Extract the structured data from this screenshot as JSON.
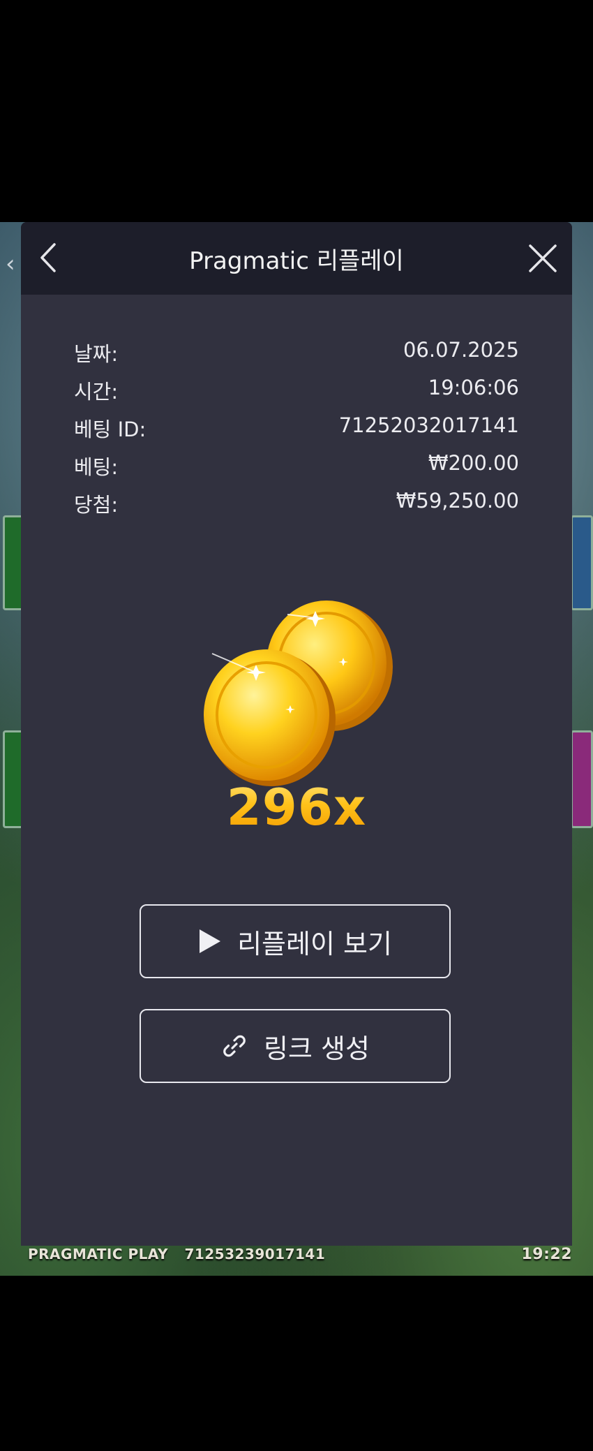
{
  "modal": {
    "title": "Pragmatic 리플레이",
    "info": [
      {
        "label": "날짜:",
        "value": "06.07.2025"
      },
      {
        "label": "시간:",
        "value": "19:06:06"
      },
      {
        "label": "베팅 ID:",
        "value": "71252032017141"
      },
      {
        "label": "베팅:",
        "value": "₩200.00"
      },
      {
        "label": "당첨:",
        "value": "₩59,250.00"
      }
    ],
    "multiplier": "296x",
    "buttons": {
      "replay_label": "리플레이 보기",
      "link_label": "링크 생성"
    }
  },
  "game_footer": {
    "brand": "PRAGMATIC PLAY",
    "round_id": "71253239017141",
    "clock": "19:22"
  },
  "icons": {
    "back": "chevron-left-icon",
    "close": "close-icon",
    "play": "play-icon",
    "link": "link-icon",
    "coins": "gold-coins-icon"
  },
  "colors": {
    "modal_bg": "#31313f",
    "header_bg": "#1d1e2a",
    "gold": "#ffc21a"
  }
}
